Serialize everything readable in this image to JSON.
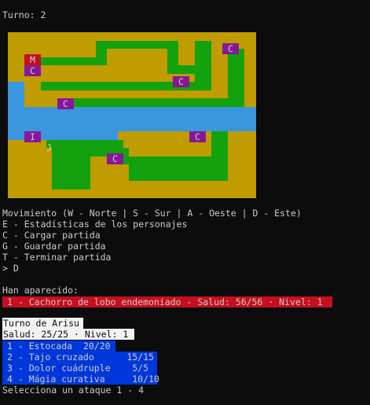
{
  "turn_label": "Turno: 2",
  "colors": {
    "background": "#0c0c0c",
    "text": "#cccccc",
    "terrain": "#c19c00",
    "path": "#13a10e",
    "water": "#3a96dd",
    "entity": "#881798",
    "enemy_highlight": "#c50f1f",
    "attack_highlight": "#0037da",
    "turn_highlight": "#f2f2f2"
  },
  "map": {
    "legend": {
      "Y": "terrain",
      "G": "path",
      "B": "water"
    },
    "rows": [
      "YYYYYYYYYYYYYYYYYYYYYYYYYYYYYYYYYYYYYYYYYYYYY",
      "YYYYYYYYYYYYYYYYGGGGGGGGGGGGGGGYYYGGGYYYYYYYY",
      "YYYYYYYYYYYYYYYYGGYYYYYYYYYYYGGYYYGGGYYYGGGYY",
      "YYYYYYGGGGGGGGGGGGYYYYYYYYYYYGGYYYGGGYYYGGGYY",
      "YYYYYYYYYYYYYYYYYYYYYYYYYYYYYGGGGGGGGYYYGGGYY",
      "YYYYYYYYYYYYYYYYYYYYYYYYYYYYYYYYYYGGGYYYGGGYY",
      "BBBYYYGGGGGGGGGGGGGGGGGGGGGGGGGGGGGGGYYYGGGYY",
      "BBBYYYYYYYYYYYYYYYYYYYYYYYYYYYYYYYYYYYYYGGGYY",
      "BBBYYYYYYYGGGGGGGGGGGGGGGGGGGGGGGGGGGGGGGGGYY",
      "BBBBBBBBBBBBBBBBBBBBBBBBBBBBBBBBBBBBBBBBBBBBB",
      "BBBBBBBBBBBBBBBBBBBBBBBBBBBBBBBBBBBBBBBBBBBBB",
      "BBBBBBBBBBBBBBBBBBBBBBBBBBBBBBBBBBBBBBBBBBBBB",
      "BBBBBBBBBBBBBBBBBBBBYYYYYYYYYYYYYYYYYGGGYYYYY",
      "YYYYYYYGGGGGGGGGGGGGGYYYYYYYYYYYYYYYYGGGYYYYY",
      "YYYYYYYYGGGGGGGGGGGGGGYYYYYYYYYYYYYYYGGGYYYYY",
      "YYYYYYYYGGGGGGGYYYYYYGGGGGGGGGGGGGGGGGGGYYYYY",
      "YYYYYYYYGGGGGGGYYYYYYYGGGGGGGGGGGGGGGGGGYYYYY",
      "YYYYYYYYGGGGGGGYYYYYYYGGGGGGGGGGGGGGGGGGYYYYY",
      "YYYYYYYYGGGGGGGYYYYYYYYYYYYYYYYYYYYYYYYYYYYYY",
      "YYYYYYYYYYYYYYYYYYYYYYYYYYYYYYYYYYYYYYYYYYYYY"
    ],
    "entities": [
      {
        "label": "C",
        "col": 13,
        "row": 1,
        "purple": true
      },
      {
        "label": "M",
        "col": 1,
        "row": 2,
        "red": true
      },
      {
        "label": "C",
        "col": 1,
        "row": 3,
        "purple": true
      },
      {
        "label": "C",
        "col": 10,
        "row": 4,
        "purple": true
      },
      {
        "label": "C",
        "col": 3,
        "row": 6,
        "purple": true
      },
      {
        "label": "I",
        "col": 1,
        "row": 9,
        "purple": true
      },
      {
        "label": "C",
        "col": 11,
        "row": 9,
        "purple": true
      },
      {
        "label": "J",
        "col": 2,
        "row": 10,
        "purple": false
      },
      {
        "label": "C",
        "col": 6,
        "row": 11,
        "purple": true
      }
    ]
  },
  "menu": {
    "movement": "Movimiento (W - Norte | S - Sur | A - Oeste | D - Este)",
    "stats": "E - Estadísticas de los personajes",
    "load": "C - Cargar partida",
    "save": "G - Guardar partida",
    "quit": "T - Terminar partida",
    "prompt": "> D"
  },
  "appeared": {
    "label": "Han aparecido:",
    "enemies": [
      "1 - Cachorro de lobo endemoniado - Salud: 56/56 · Nivel: 1"
    ]
  },
  "turn_of": {
    "title": "Turno de Arisu",
    "stats": "Salud: 25/25 · Nivel: 1"
  },
  "attacks": [
    {
      "text": "1 - Estocada  20/20"
    },
    {
      "text": "2 - Tajo cruzado      15/15"
    },
    {
      "text": "3 - Dolor cuádruple    5/5"
    },
    {
      "text": "4 - Mágia curativa     10/10"
    }
  ],
  "select_prompt": "Selecciona un ataque 1 - 4"
}
